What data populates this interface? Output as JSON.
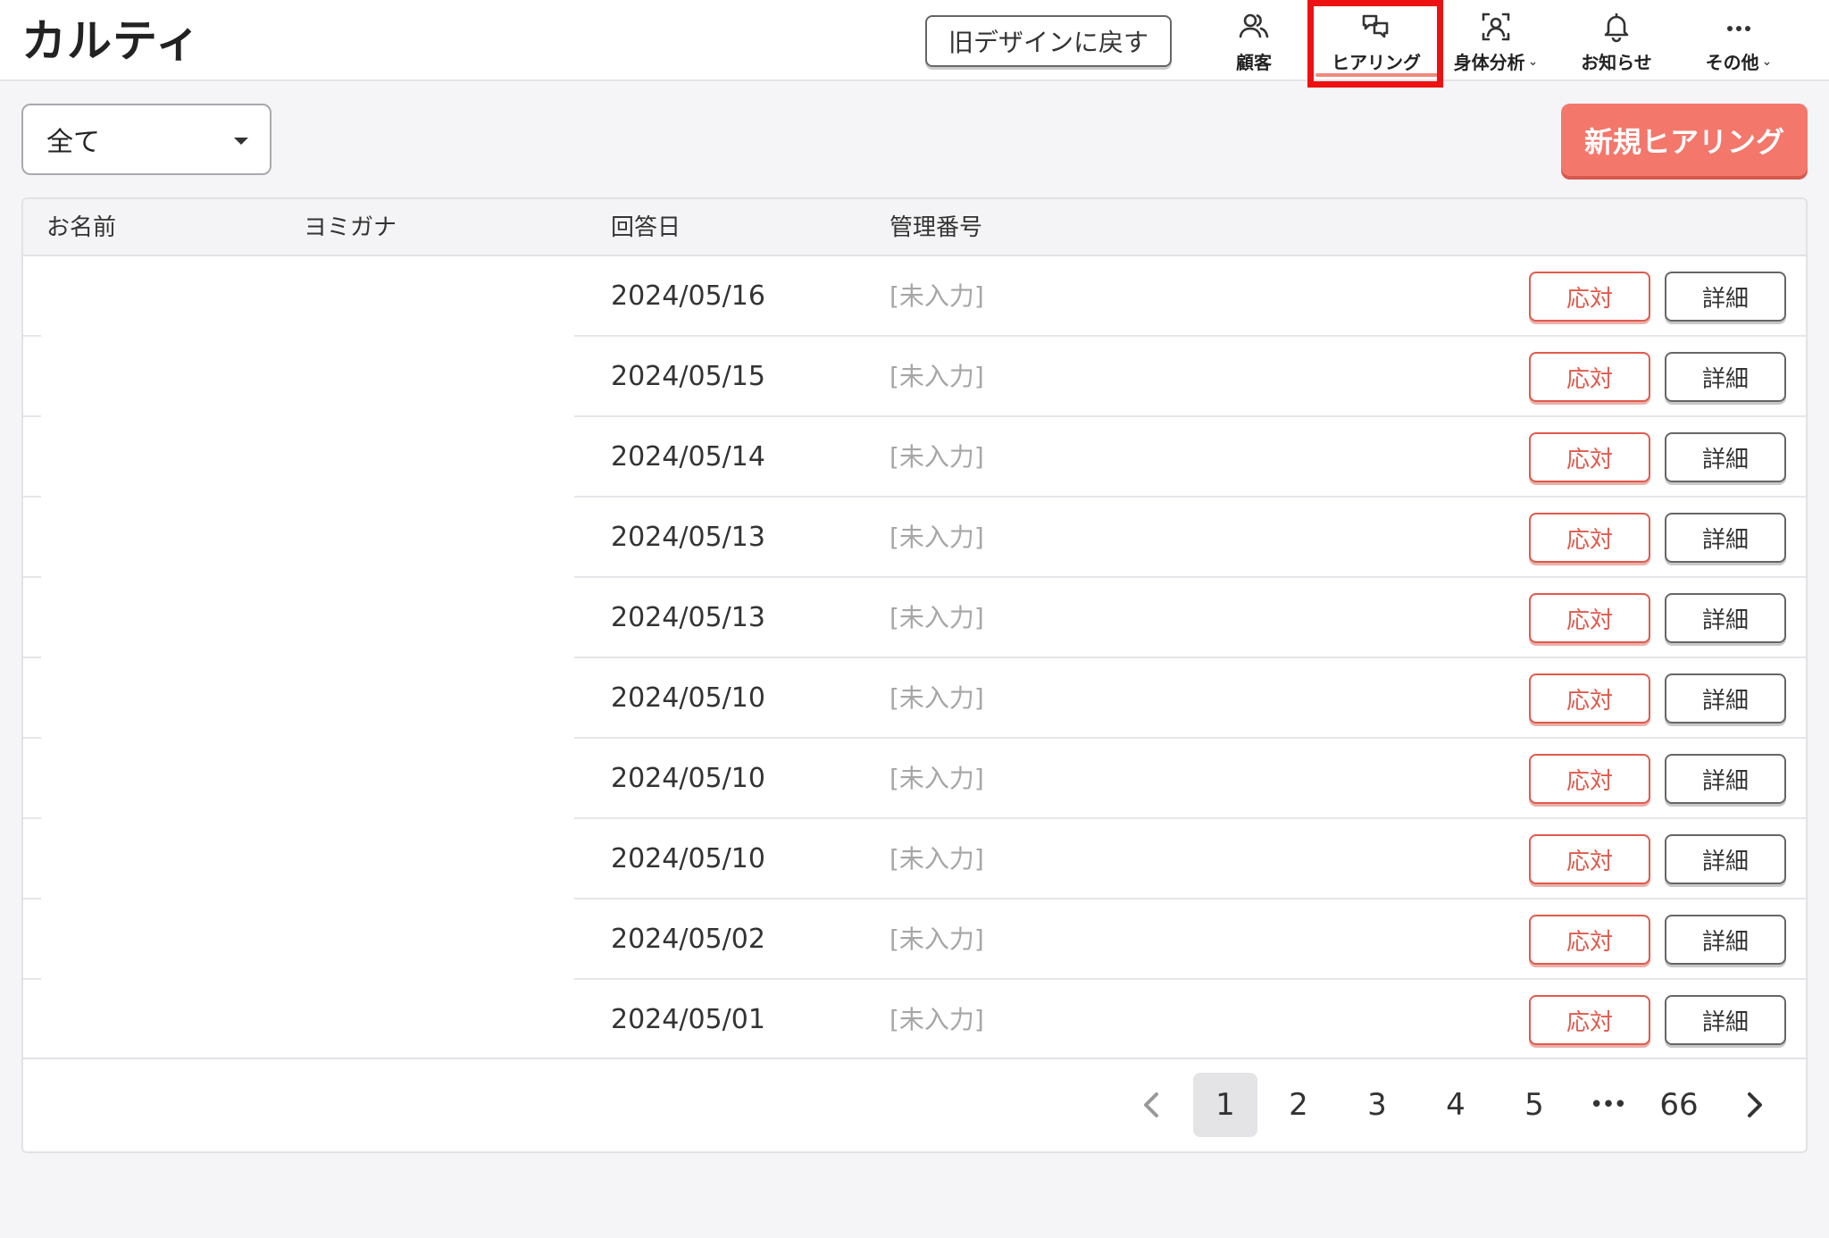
{
  "header": {
    "logo": "カルティ",
    "old_design_button": "旧デザインに戻す",
    "nav": {
      "customers": "顧客",
      "hearing": "ヒアリング",
      "body_analysis": "身体分析",
      "notifications": "お知らせ",
      "others": "その他"
    },
    "active_nav": "hearing",
    "accent_color": "#f3776b"
  },
  "toolbar": {
    "filter_value": "全て",
    "new_button": "新規ヒアリング"
  },
  "table": {
    "columns": {
      "name": "お名前",
      "kana": "ヨミガナ",
      "answer_date": "回答日",
      "management_no": "管理番号"
    },
    "rows": [
      {
        "date": "2024/05/16",
        "number": "[未入力]",
        "respond": "応対",
        "detail": "詳細"
      },
      {
        "date": "2024/05/15",
        "number": "[未入力]",
        "respond": "応対",
        "detail": "詳細"
      },
      {
        "date": "2024/05/14",
        "number": "[未入力]",
        "respond": "応対",
        "detail": "詳細"
      },
      {
        "date": "2024/05/13",
        "number": "[未入力]",
        "respond": "応対",
        "detail": "詳細"
      },
      {
        "date": "2024/05/13",
        "number": "[未入力]",
        "respond": "応対",
        "detail": "詳細"
      },
      {
        "date": "2024/05/10",
        "number": "[未入力]",
        "respond": "応対",
        "detail": "詳細"
      },
      {
        "date": "2024/05/10",
        "number": "[未入力]",
        "respond": "応対",
        "detail": "詳細"
      },
      {
        "date": "2024/05/10",
        "number": "[未入力]",
        "respond": "応対",
        "detail": "詳細"
      },
      {
        "date": "2024/05/02",
        "number": "[未入力]",
        "respond": "応対",
        "detail": "詳細"
      },
      {
        "date": "2024/05/01",
        "number": "[未入力]",
        "respond": "応対",
        "detail": "詳細"
      }
    ]
  },
  "pagination": {
    "current": "1",
    "pages": [
      "1",
      "2",
      "3",
      "4",
      "5"
    ],
    "ellipsis": "•••",
    "last": "66"
  }
}
